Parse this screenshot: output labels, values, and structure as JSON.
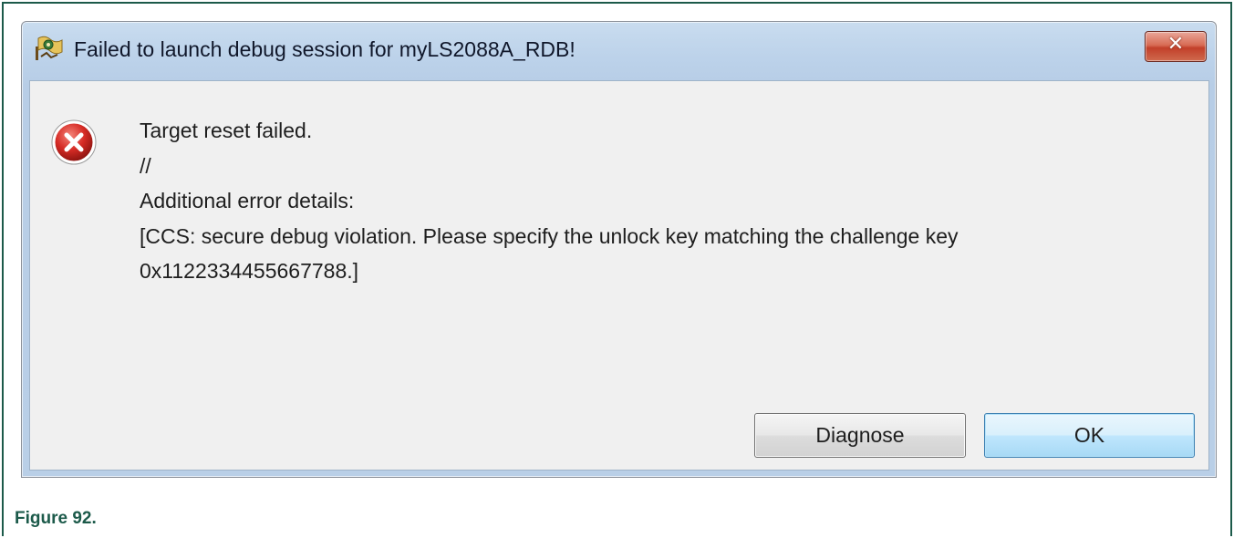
{
  "dialog": {
    "title": "Failed to launch debug session for myLS2088A_RDB!",
    "close_label": "✕",
    "message_lines": [
      "Target reset failed.",
      "//",
      "Additional error details:",
      "[CCS: secure debug violation. Please specify the unlock key matching the challenge key",
      "0x1122334455667788.]"
    ],
    "buttons": {
      "diagnose": "Diagnose",
      "ok": "OK"
    }
  },
  "caption": "Figure 92.",
  "icons": {
    "app": "debug-app-icon",
    "status": "error-icon",
    "close": "close-icon"
  },
  "colors": {
    "caption": "#1c5a4a",
    "error": "#d62b25",
    "close_button": "#c9503a",
    "ok_border": "#3c7fb1"
  }
}
